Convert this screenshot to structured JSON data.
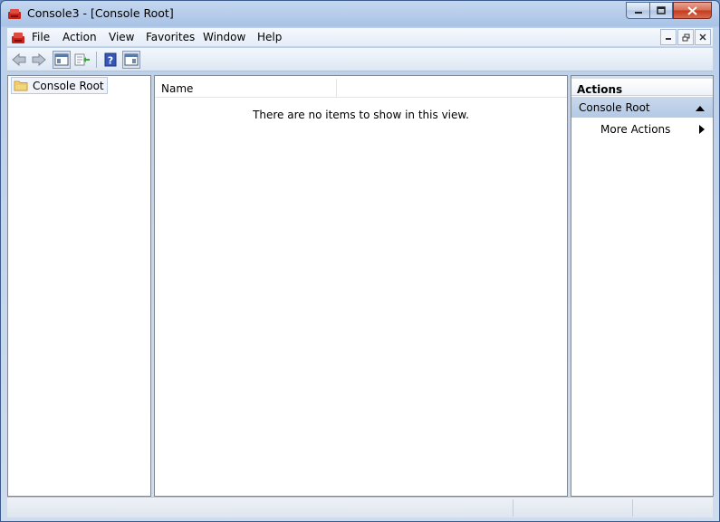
{
  "window": {
    "title": "Console3 - [Console Root]"
  },
  "menu": {
    "items": [
      "File",
      "Action",
      "View",
      "Favorites",
      "Window",
      "Help"
    ]
  },
  "toolbar": {
    "buttons": [
      "back-arrow-icon",
      "forward-arrow-icon",
      "show-hide-console-tree-icon",
      "export-list-icon",
      "help-icon",
      "show-hide-action-pane-icon"
    ]
  },
  "tree": {
    "root_label": "Console Root"
  },
  "list": {
    "columns": [
      "Name"
    ],
    "empty_message": "There are no items to show in this view."
  },
  "actions": {
    "header": "Actions",
    "group_label": "Console Root",
    "items": [
      "More Actions"
    ]
  },
  "colors": {
    "accent": "#b3c9e5",
    "close_button": "#c43a1c"
  }
}
